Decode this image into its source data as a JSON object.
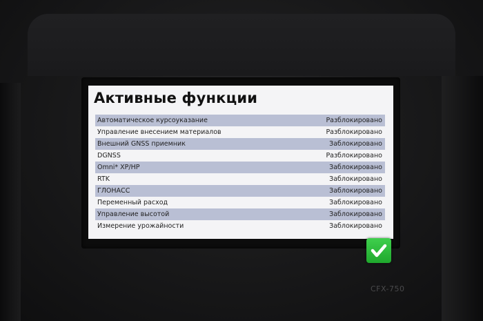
{
  "screen": {
    "title": "Активные функции",
    "features": [
      {
        "name": "Автоматическое курсоуказание",
        "status": "Разблокировано"
      },
      {
        "name": "Управление внесением материалов",
        "status": "Разблокировано"
      },
      {
        "name": "Внешний GNSS приемник",
        "status": "Заблокировано"
      },
      {
        "name": "DGNSS",
        "status": "Разблокировано"
      },
      {
        "name": "Omni* XP/HP",
        "status": "Заблокировано"
      },
      {
        "name": "RTK",
        "status": "Заблокировано"
      },
      {
        "name": "ГЛОНАСС",
        "status": "Заблокировано"
      },
      {
        "name": "Переменный расход",
        "status": "Заблокировано"
      },
      {
        "name": "Управление высотой",
        "status": "Заблокировано"
      },
      {
        "name": "Измерение урожайности",
        "status": "Заблокировано"
      }
    ]
  },
  "confirm_button": {
    "icon": "checkmark-icon",
    "color": "#2fbf3c"
  },
  "device": {
    "model": "CFX-750"
  }
}
